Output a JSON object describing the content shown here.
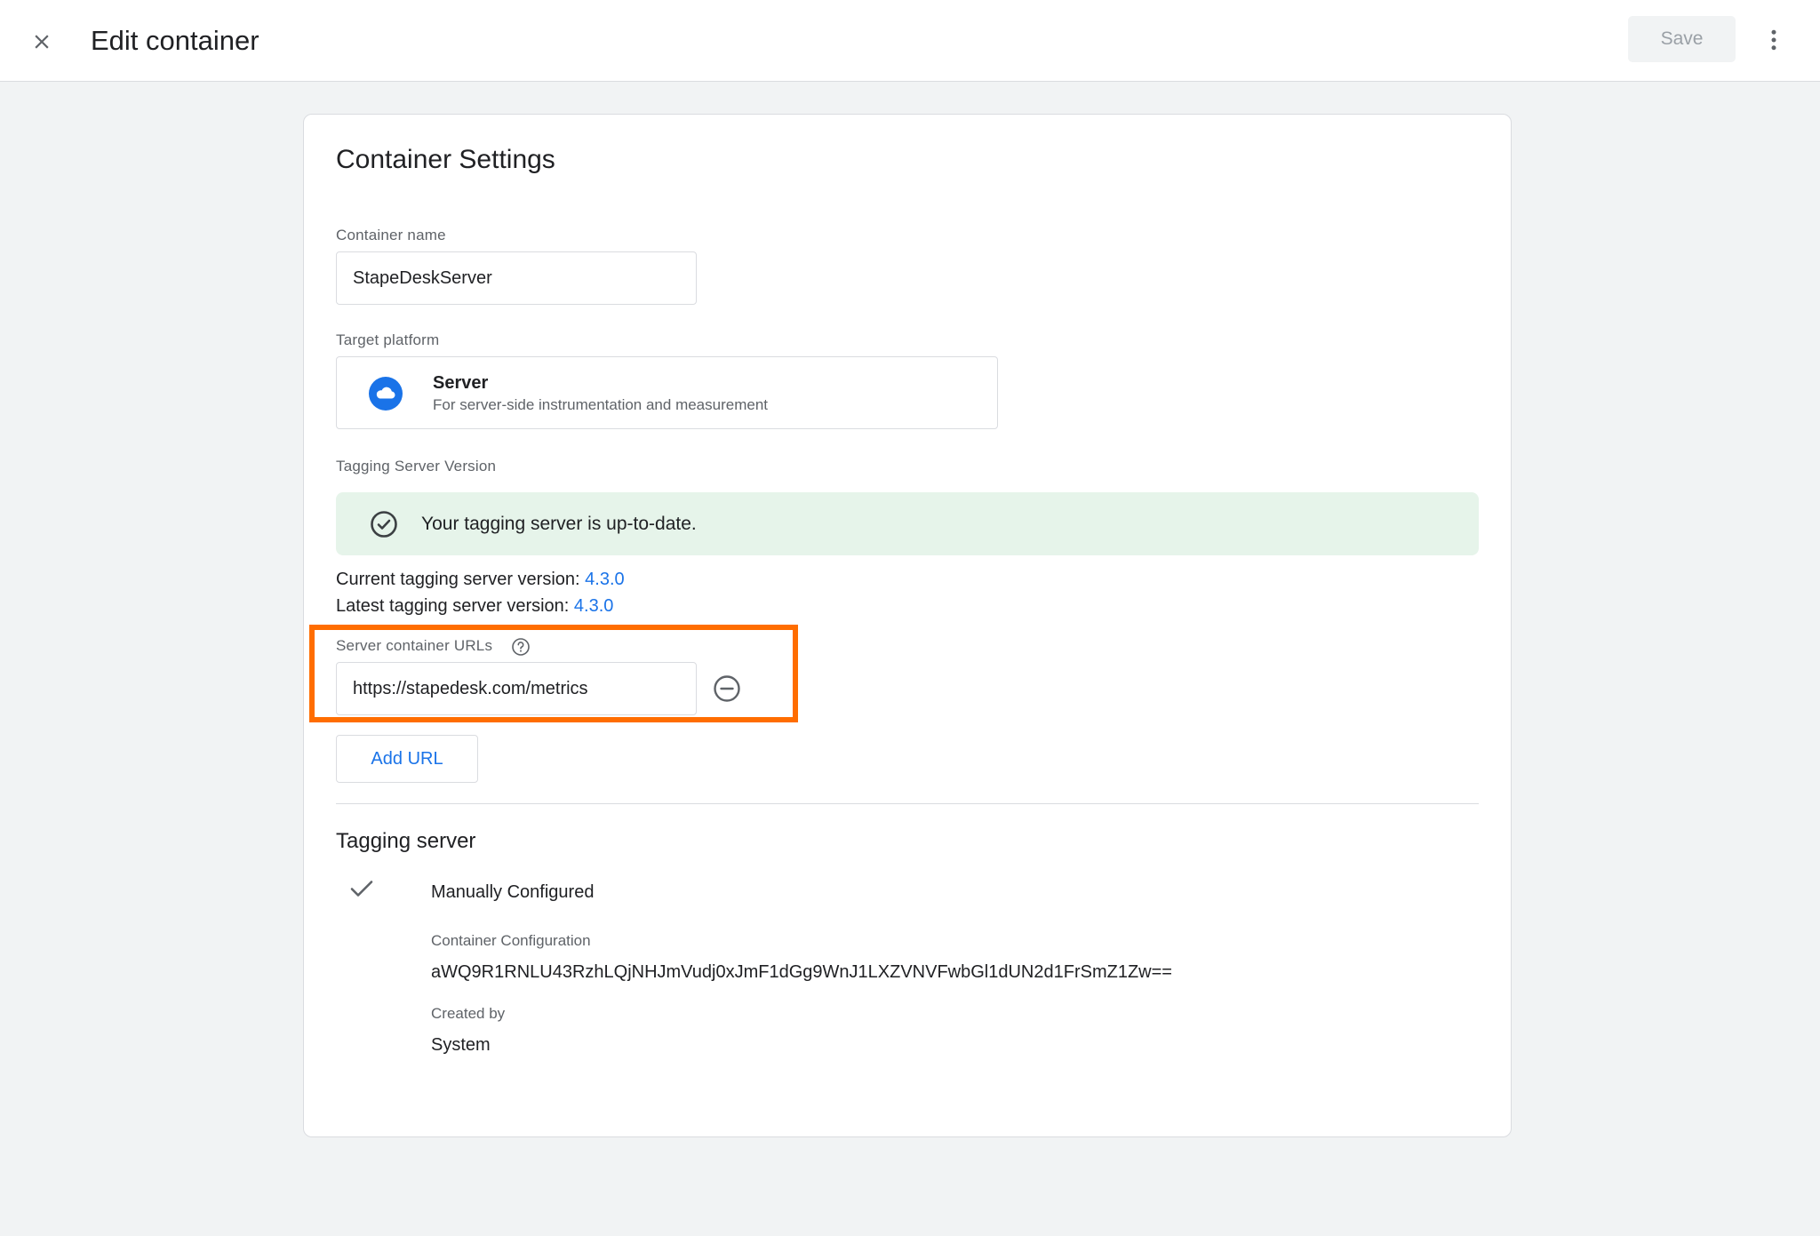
{
  "header": {
    "title": "Edit container",
    "save_label": "Save"
  },
  "card": {
    "title": "Container Settings",
    "container_name": {
      "label": "Container name",
      "value": "StapeDeskServer"
    },
    "target_platform": {
      "label": "Target platform",
      "name": "Server",
      "description": "For server-side instrumentation and measurement",
      "icon": "cloud-icon"
    },
    "tagging_server_version": {
      "label": "Tagging Server Version",
      "status_text": "Your tagging server is up-to-date.",
      "current_label": "Current tagging server version: ",
      "current_value": "4.3.0",
      "latest_label": "Latest tagging server version: ",
      "latest_value": "4.3.0"
    },
    "server_urls": {
      "label": "Server container URLs",
      "urls": [
        "https://stapedesk.com/metrics"
      ],
      "add_label": "Add URL"
    },
    "tagging_server": {
      "title": "Tagging server",
      "mode": "Manually Configured",
      "config_label": "Container Configuration",
      "config_value": "aWQ9R1RNLU43RzhLQjNHJmVudj0xJmF1dGg9WnJ1LXZVNVFwbGl1dUN2d1FrSmZ1Zw==",
      "created_by_label": "Created by",
      "created_by_value": "System"
    }
  },
  "colors": {
    "accent": "#1a73e8",
    "highlight": "#ff6d00",
    "success_bg": "#e6f4ea"
  }
}
